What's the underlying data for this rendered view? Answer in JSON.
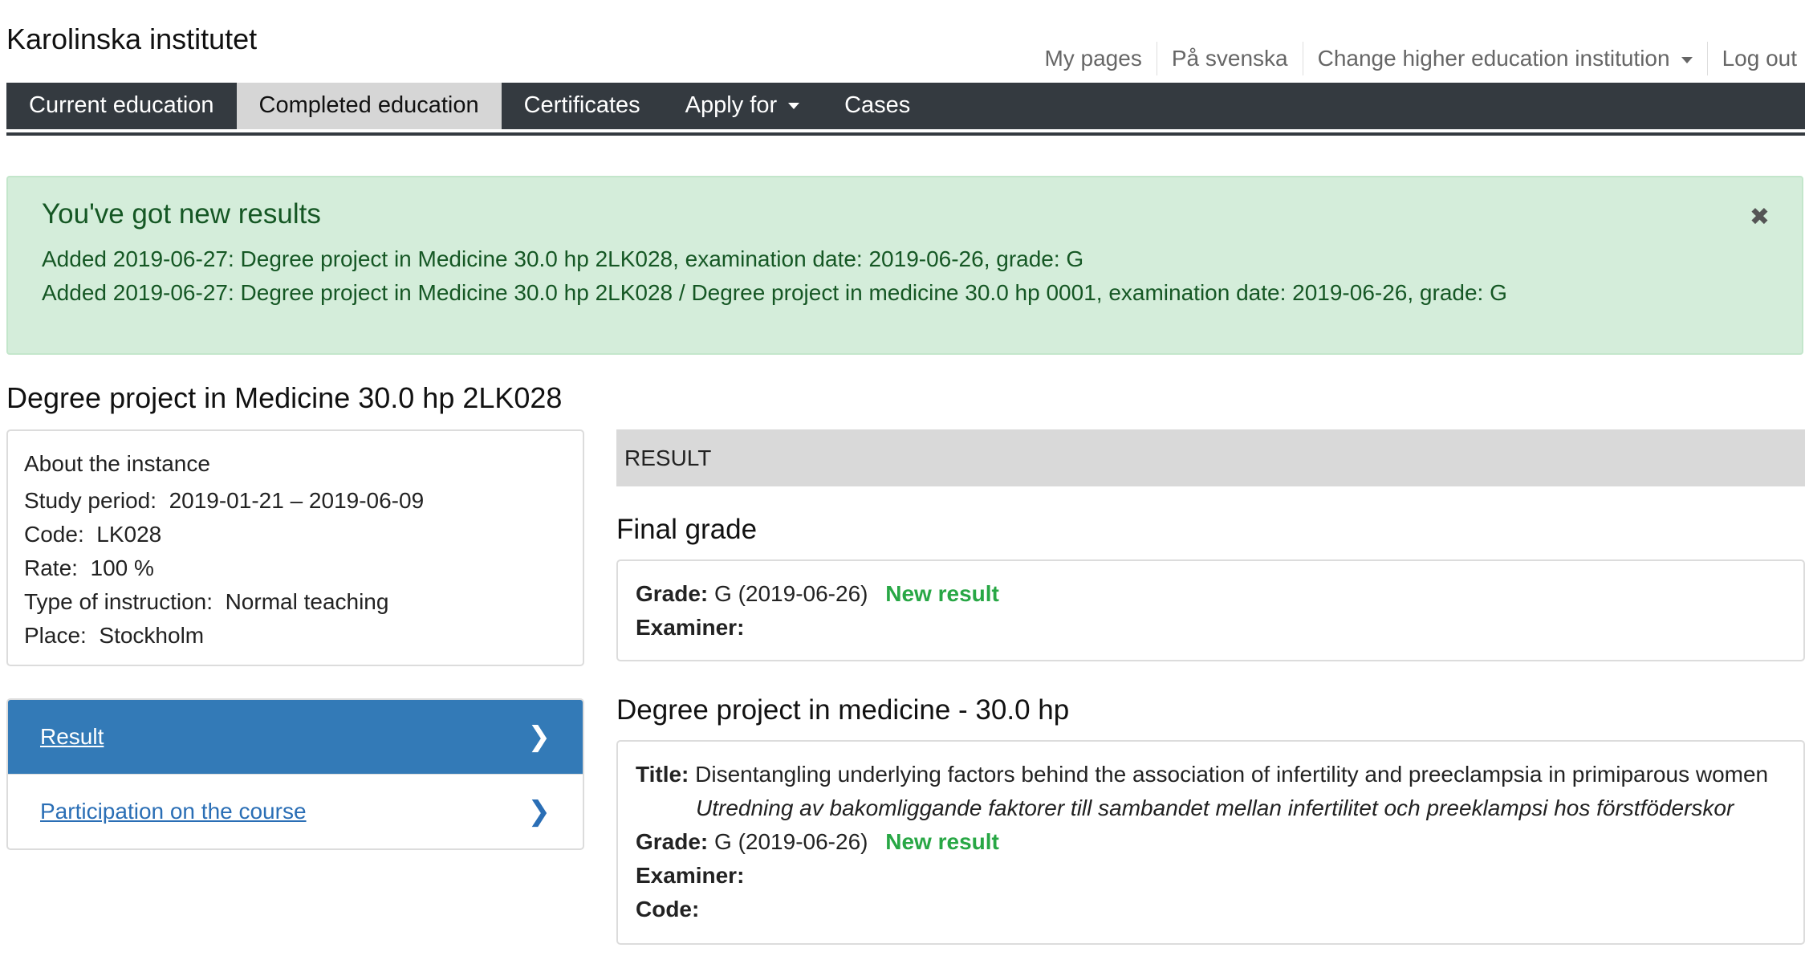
{
  "brand": "Karolinska institutet",
  "top_links": {
    "my_pages": "My pages",
    "swedish": "På svenska",
    "change_institution": "Change higher education institution",
    "logout": "Log out"
  },
  "nav": [
    {
      "label": "Current education"
    },
    {
      "label": "Completed education"
    },
    {
      "label": "Certificates"
    },
    {
      "label": "Apply for"
    },
    {
      "label": "Cases"
    }
  ],
  "alert": {
    "title": "You've got new results",
    "lines": [
      "Added 2019-06-27: Degree project in Medicine 30.0 hp 2LK028, examination date: 2019-06-26, grade: G",
      "Added 2019-06-27: Degree project in Medicine 30.0 hp 2LK028 / Degree project in medicine 30.0 hp 0001, examination date: 2019-06-26, grade: G"
    ],
    "close": "✖"
  },
  "page_title": "Degree project in Medicine 30.0 hp 2LK028",
  "about": {
    "heading": "About the instance",
    "study_period_label": "Study period:",
    "study_period": "2019-01-21 – 2019-06-09",
    "code_label": "Code:",
    "code": "LK028",
    "rate_label": "Rate:",
    "rate": "100 %",
    "type_label": "Type of instruction:",
    "type": "Normal teaching",
    "place_label": "Place:",
    "place": "Stockholm"
  },
  "sidenav": {
    "result": "Result",
    "participation": "Participation on the course",
    "chevron": "❯"
  },
  "result_header": "RESULT",
  "final_grade": {
    "heading": "Final grade",
    "grade_label": "Grade:",
    "grade": "G (2019-06-26)",
    "new_result": "New result",
    "examiner_label": "Examiner:"
  },
  "module": {
    "heading": "Degree project in medicine - 30.0 hp",
    "title_label": "Title:",
    "title": "Disentangling underlying factors behind the association of infertility and preeclampsia in primiparous women",
    "title_sv": "Utredning av bakomliggande faktorer till sambandet mellan infertilitet och preeklampsi hos förstföderskor",
    "grade_label": "Grade:",
    "grade": "G (2019-06-26)",
    "new_result": "New result",
    "examiner_label": "Examiner:",
    "code_label": "Code:"
  }
}
